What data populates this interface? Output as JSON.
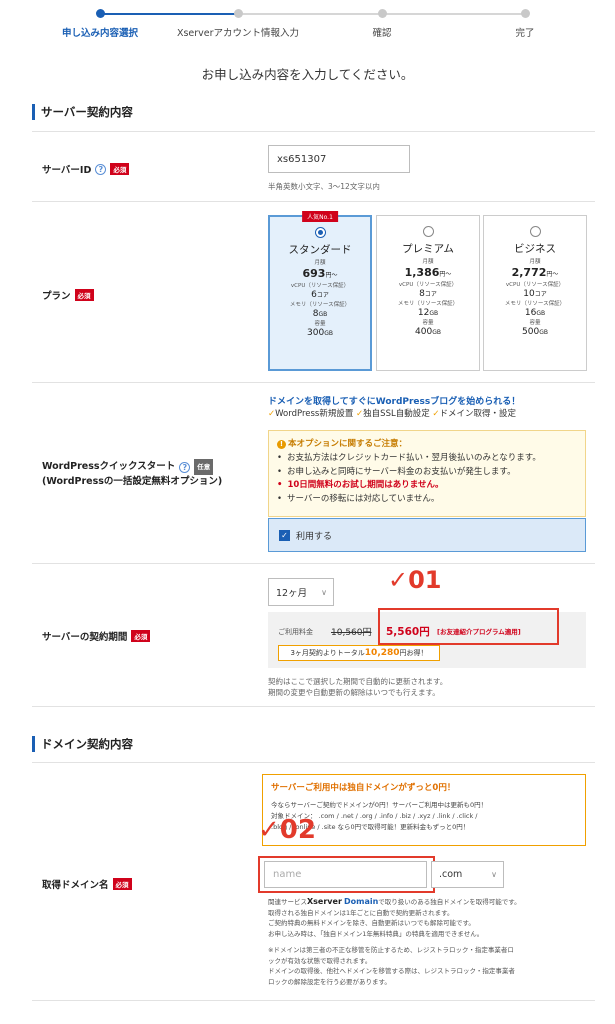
{
  "stepper": {
    "steps": [
      "申し込み内容選択",
      "Xserverアカウント情報入力",
      "確認",
      "完了"
    ]
  },
  "intro": "お申し込み内容を入力してください。",
  "server_section": {
    "title": "サーバー契約内容",
    "server_id": {
      "label": "サーバーID",
      "required": "必須",
      "value": "xs651307",
      "hint": "半角英数小文字、3～12文字以内"
    },
    "plan": {
      "label": "プラン",
      "required": "必須",
      "plans": [
        {
          "badge": "人気No.1",
          "name": "スタンダード",
          "monthly_label": "月額",
          "price": "693",
          "price_unit": "円～",
          "vcpu_label": "vCPU（リソース保証）",
          "vcpu": "6",
          "vcpu_unit": "コア",
          "mem_label": "メモリ（リソース保証）",
          "mem": "8",
          "mem_unit": "GB",
          "disk_label": "容量",
          "disk": "300",
          "disk_unit": "GB",
          "selected": true
        },
        {
          "badge": "",
          "name": "プレミアム",
          "monthly_label": "月額",
          "price": "1,386",
          "price_unit": "円～",
          "vcpu_label": "vCPU（リソース保証）",
          "vcpu": "8",
          "vcpu_unit": "コア",
          "mem_label": "メモリ（リソース保証）",
          "mem": "12",
          "mem_unit": "GB",
          "disk_label": "容量",
          "disk": "400",
          "disk_unit": "GB",
          "selected": false
        },
        {
          "badge": "",
          "name": "ビジネス",
          "monthly_label": "月額",
          "price": "2,772",
          "price_unit": "円～",
          "vcpu_label": "vCPU（リソース保証）",
          "vcpu": "10",
          "vcpu_unit": "コア",
          "mem_label": "メモリ（リソース保証）",
          "mem": "16",
          "mem_unit": "GB",
          "disk_label": "容量",
          "disk": "500",
          "disk_unit": "GB",
          "selected": false
        }
      ]
    },
    "wordpress": {
      "label_line1": "WordPressクイックスタート",
      "optional": "任意",
      "label_line2": "(WordPressの一括設定無料オプション)",
      "headline": "ドメインを取得してすぐにWordPressブログを始められる！",
      "checks": [
        "WordPress新規設置",
        "独自SSL自動設定",
        "ドメイン取得・設定"
      ],
      "notice_title": "本オプションに関するご注意：",
      "notices": [
        "お支払方法はクレジットカード払い・翌月後払いのみとなります。",
        "お申し込みと同時にサーバー料金のお支払いが発生します。",
        "10日間無料のお試し期間はありません。",
        "サーバーの移転には対応していません。"
      ],
      "use_label": "利用する"
    },
    "period": {
      "label": "サーバーの契約期間",
      "required": "必須",
      "selected": "12ヶ月",
      "fee_label": "ご利用料金",
      "old_price": "10,560円",
      "new_price": "5,560円",
      "program_note": "[お友達紹介プログラム適用]",
      "total_prefix": "3ヶ月契約よりトータル",
      "total_amount": "10,280",
      "total_suffix": "円お得！",
      "desc1": "契約はここで選択した期間で自動的に更新されます。",
      "desc2": "期間の変更や自動更新の解除はいつでも行えます。",
      "annotation": "✓01"
    }
  },
  "domain_section": {
    "title": "ドメイン契約内容",
    "label": "取得ドメイン名",
    "required": "必須",
    "promo_title": "サーバーご利用中は独自ドメインがずっと0円！",
    "promo_line1": "今ならサーバーご契約でドメインが0円！サーバーご利用中は更新も0円！",
    "promo_line2": "対象ドメイン： .com / .net / .org / .info / .biz / .xyz / .link / .click /",
    "promo_line3": ".blog / .online / .site なら0円で取得可能！更新料金もずっと0円！",
    "input_placeholder": "name",
    "tld": ".com",
    "desc_prefix": "関連サービス",
    "desc_brand": "Xserver",
    "desc_brand2": "Domain",
    "desc_suffix": "で取り扱いのある独自ドメインを取得可能です。",
    "desc_lines": [
      "取得される独自ドメインは1年ごとに自動で契約更新されます。",
      "ご契約特典の無料ドメインを除き、自動更新はいつでも解除可能です。",
      "お申し込み時は、「独自ドメイン1年無料特典」の特典を適用できません。"
    ],
    "note_lines": [
      "※ドメインは第三者の不正な移管を防止するため、レジストラロック・指定事業者ロ",
      "ックが有効な状態で取得されます。",
      "ドメインの取得後、他社へドメインを移管する際は、レジストラロック・指定事業者",
      "ロックの解除設定を行う必要があります。"
    ],
    "annotation": "✓02"
  }
}
